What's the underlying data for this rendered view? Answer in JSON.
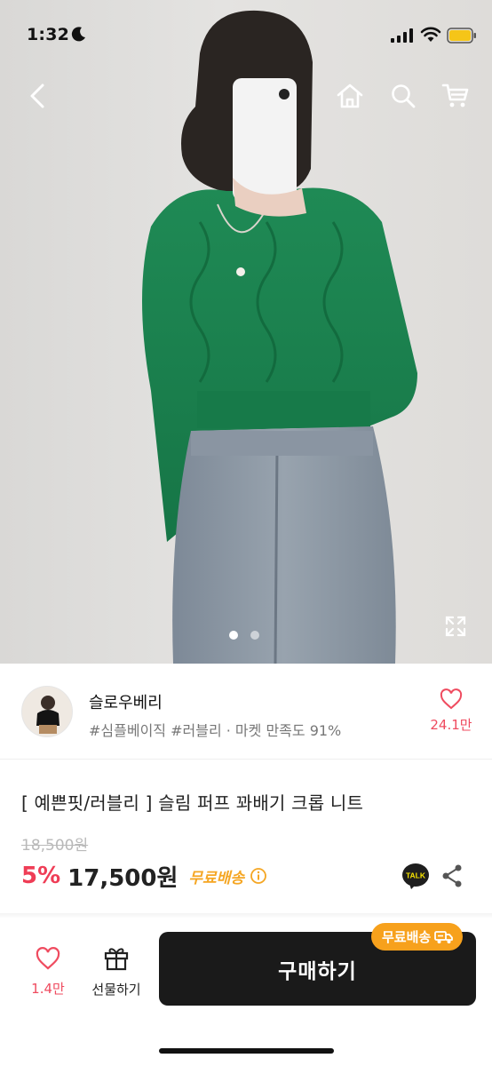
{
  "status_bar": {
    "time": "1:32"
  },
  "nav": {
    "back": "chevron-left-icon",
    "home": "home-icon",
    "search": "search-icon",
    "cart": "cart-icon"
  },
  "gallery": {
    "current": 1,
    "total": 2
  },
  "shop": {
    "name": "슬로우베리",
    "tags": "#심플베이직 #러블리 · 마켓 만족도 91%",
    "likes": "24.1만"
  },
  "product": {
    "title": "[ 예쁜핏/러블리 ] 슬림  퍼프 꽈배기 크롭 니트",
    "original_price": "18,500원",
    "discount": "5%",
    "price": "17,500원",
    "free_shipping": "무료배송",
    "talk_label": "TALK"
  },
  "bottom_bar": {
    "likes": "1.4만",
    "gift_label": "선물하기",
    "buy_label": "구매하기",
    "buy_badge": "무료배송"
  },
  "colors": {
    "accent_red": "#ef3d56",
    "badge_orange": "#f7a11c",
    "buy_bg": "#1a1a1a"
  }
}
